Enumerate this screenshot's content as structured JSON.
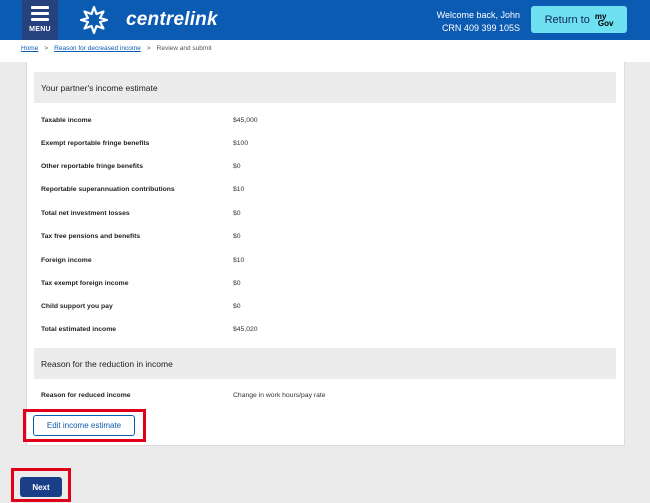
{
  "header": {
    "menu_label": "MENU",
    "brand": "centrelink",
    "welcome_line": "Welcome back, John",
    "crn_line": "CRN 409 399 105S",
    "return_label": "Return to",
    "mygov_my": "my",
    "mygov_gov": "Gov"
  },
  "breadcrumb": {
    "home": "Home",
    "sep1": ">",
    "reason": "Reason for decreased income",
    "sep2": ">",
    "current": "Review and submit"
  },
  "partner_section": {
    "title": "Your partner's income estimate",
    "rows": [
      {
        "label": "Taxable income",
        "value": "$45,000"
      },
      {
        "label": "Exempt reportable fringe benefits",
        "value": "$100"
      },
      {
        "label": "Other reportable fringe benefits",
        "value": "$0"
      },
      {
        "label": "Reportable superannuation contributions",
        "value": "$10"
      },
      {
        "label": "Total net investment losses",
        "value": "$0"
      },
      {
        "label": "Tax free pensions and benefits",
        "value": "$0"
      },
      {
        "label": "Foreign income",
        "value": "$10"
      },
      {
        "label": "Tax exempt foreign income",
        "value": "$0"
      },
      {
        "label": "Child support you pay",
        "value": "$0"
      },
      {
        "label": "Total estimated income",
        "value": "$45,020"
      }
    ]
  },
  "reason_section": {
    "title": "Reason for the reduction in income",
    "rows": [
      {
        "label": "Reason for reduced income",
        "value": "Change in work hours/pay rate"
      }
    ]
  },
  "buttons": {
    "edit_label": "Edit income estimate",
    "next_label": "Next"
  },
  "colors": {
    "header_blue": "#0c5bb3",
    "menu_navy": "#25417e",
    "mygov_cyan": "#6ee0f2",
    "next_navy": "#1b3e88",
    "highlight_red": "#e1001a"
  }
}
